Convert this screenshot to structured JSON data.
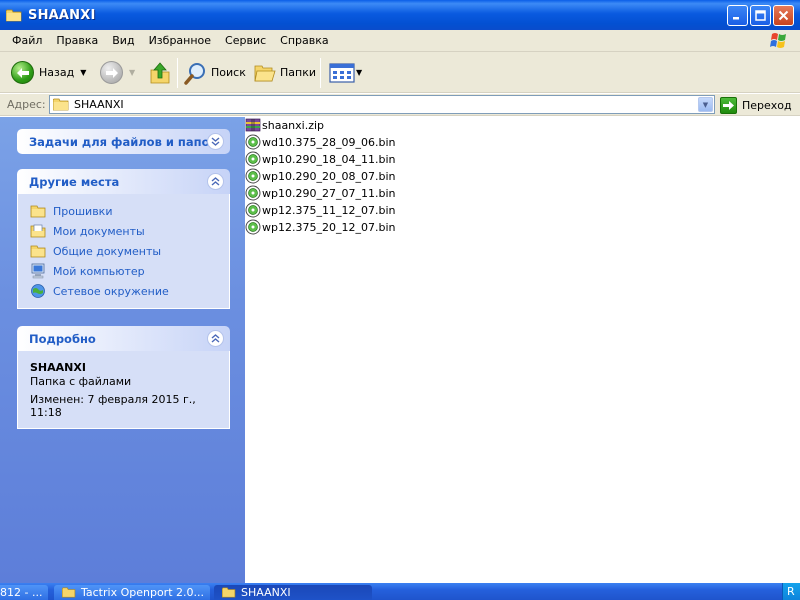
{
  "window": {
    "title": "SHAANXI"
  },
  "menu": {
    "items": [
      "Файл",
      "Правка",
      "Вид",
      "Избранное",
      "Сервис",
      "Справка"
    ]
  },
  "toolbar": {
    "back_label": "Назад",
    "search_label": "Поиск",
    "folders_label": "Папки"
  },
  "address": {
    "label": "Адрес:",
    "value": "SHAANXI",
    "go_label": "Переход"
  },
  "tasks_panel": {
    "title": "Задачи для файлов и папок"
  },
  "places_panel": {
    "title": "Другие места",
    "items": [
      {
        "label": "Прошивки",
        "icon": "folder-icon"
      },
      {
        "label": "Мои документы",
        "icon": "my-documents-icon"
      },
      {
        "label": "Общие документы",
        "icon": "folder-icon"
      },
      {
        "label": "Мой компьютер",
        "icon": "my-computer-icon"
      },
      {
        "label": "Сетевое окружение",
        "icon": "network-icon"
      }
    ]
  },
  "details_panel": {
    "title": "Подробно",
    "name": "SHAANXI",
    "type": "Папка с файлами",
    "modified": "Изменен: 7 февраля 2015 г., 11:18"
  },
  "files": [
    {
      "name": "shaanxi.zip",
      "icon": "zip-archive-icon"
    },
    {
      "name": "wd10.375_28_09_06.bin",
      "icon": "bin-file-icon"
    },
    {
      "name": "wp10.290_18_04_11.bin",
      "icon": "bin-file-icon"
    },
    {
      "name": "wp10.290_20_08_07.bin",
      "icon": "bin-file-icon"
    },
    {
      "name": "wp10.290_27_07_11.bin",
      "icon": "bin-file-icon"
    },
    {
      "name": "wp12.375_11_12_07.bin",
      "icon": "bin-file-icon"
    },
    {
      "name": "wp12.375_20_12_07.bin",
      "icon": "bin-file-icon"
    }
  ],
  "taskbar": {
    "buttons": [
      {
        "label": "812 - ..."
      },
      {
        "label": "Tactrix Openport 2.0..."
      },
      {
        "label": "SHAANXI"
      }
    ],
    "tray_text": "R"
  },
  "colors": {
    "accent": "#215dc6",
    "titlebar": "#0a5ae0",
    "panel_bg": "#d6dff7"
  }
}
